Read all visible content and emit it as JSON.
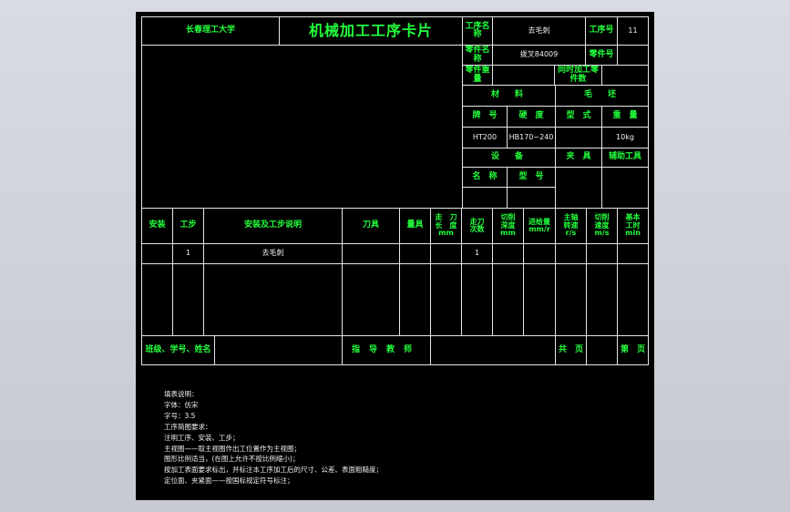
{
  "header": {
    "school": "长春理工大学",
    "title": "机械加工工序卡片",
    "process_name_label": "工序名称",
    "process_name_value": "去毛刺",
    "process_no_label": "工序号",
    "process_no_value": "11",
    "part_name_label": "零件名称",
    "part_name_value": "拨叉84009",
    "part_no_label": "零件号",
    "part_weight_label": "零件重量",
    "same_time_label": "同时加工零件数"
  },
  "material": {
    "section_label": "材　料",
    "blank_label": "毛　坯",
    "grade_label": "牌　号",
    "hardness_label": "硬　度",
    "type_label": "型　式",
    "weight_label": "重　量",
    "grade_value": "HT200",
    "hardness_value": "HB170~240",
    "weight_value": "10kg"
  },
  "equipment": {
    "equipment_label": "设　备",
    "fixture_label": "夹　具",
    "aux_tool_label": "辅助工具",
    "name_label": "名　称",
    "model_label": "型　号"
  },
  "table": {
    "headers": {
      "setup": "安装",
      "step": "工步",
      "description": "安装及工步说明",
      "tool": "刀具",
      "gauge": "量具",
      "travel": [
        "走　刀",
        "长　度",
        "mm"
      ],
      "passes": [
        "走刀",
        "次数"
      ],
      "depth": [
        "切削",
        "深度",
        "mm"
      ],
      "feed": [
        "进给量",
        "mm/r"
      ],
      "spindle": [
        "主轴",
        "转速",
        "r/s"
      ],
      "speed": [
        "切削",
        "速度",
        "m/s"
      ],
      "time": [
        "基本",
        "工时",
        "min"
      ]
    },
    "row": {
      "step": "1",
      "description": "去毛刺",
      "passes": "1"
    }
  },
  "footer": {
    "signature_label": "班级、学号、姓名",
    "advisor_label": "指导教师",
    "sheet_total_label": "共　页",
    "sheet_no_label": "第　页"
  },
  "notes": [
    "填表说明：",
    "字体：仿宋",
    "字号：3.5",
    "工序简图要求：",
    "注明工序、安装、工步；",
    "主视图——取主视图作出工位置作为主视图；",
    "图形比例适当，(在图上允许不按比例缩小)；",
    "按加工表面要求标出，并标注本工序加工后的尺寸、公差、表面粗糙度；",
    "定位面、夹紧面——按国标规定符号标注；"
  ]
}
